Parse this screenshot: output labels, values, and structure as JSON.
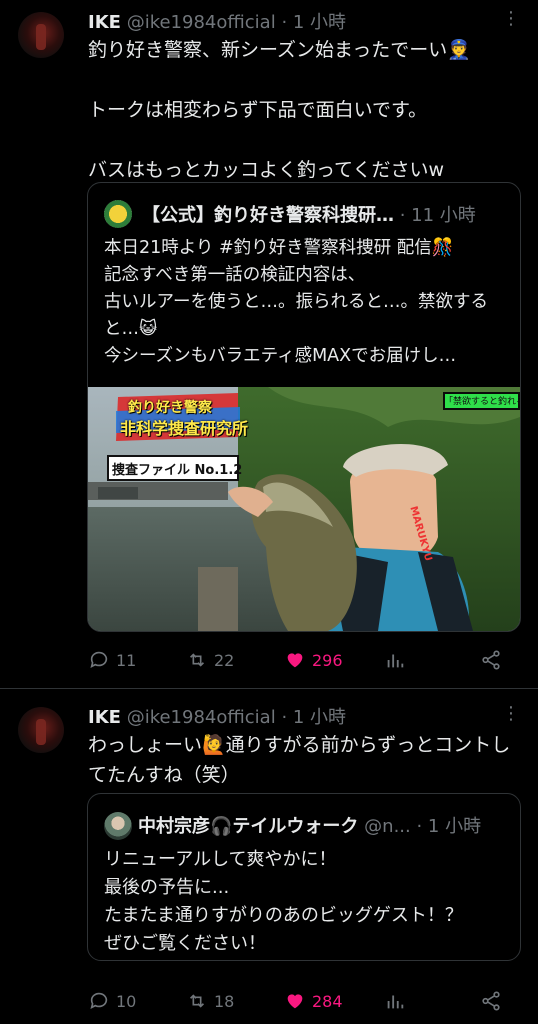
{
  "tweets": [
    {
      "author_name": "IKE",
      "handle": "@ike1984official",
      "time": "· 1 小時",
      "text": "釣り好き警察、新シーズン始まったでーい👮\n\nトークは相変わらず下品で面白いです。\n\nバスはもっとカッコよく釣ってくださいw",
      "quote": {
        "author": "【公式】釣り好き警察科捜研…",
        "time": "· 11 小時",
        "text": "本日21時より #釣り好き警察科捜研 配信🎊\n記念すべき第一話の検証内容は、\n古いルアーを使うと…。振られると…。禁欲すると…😺\n今シーズンもバラエティ感MAXでお届けし…",
        "media": {
          "title_line1": "釣り好き警察",
          "title_line2": "非科学捜査研究所",
          "file_label": "捜査ファイル No.1.2",
          "banner": "「禁欲すると釣れる」検証中",
          "brand": "MARUKYU"
        }
      },
      "replies": "11",
      "retweets": "22",
      "likes": "296"
    },
    {
      "author_name": "IKE",
      "handle": "@ike1984official",
      "time": "· 1 小時",
      "text": "わっしょーい🙋通りすがる前からずっとコントしてたんすね（笑）",
      "quote": {
        "author": "中村宗彦🎧テイルウォーク",
        "handle": "@n...",
        "time": "· 1 小時",
        "text": "リニューアルして爽やかに！\n最後の予告に...\nたまたま通りすがりのあのビッグゲスト！？\nぜひご覧ください！"
      },
      "replies": "10",
      "retweets": "18",
      "likes": "284"
    }
  ],
  "colors": {
    "like": "#f91880",
    "muted": "#71767b",
    "text": "#e7e9ea",
    "border": "#2f3336",
    "bg": "#000000"
  }
}
